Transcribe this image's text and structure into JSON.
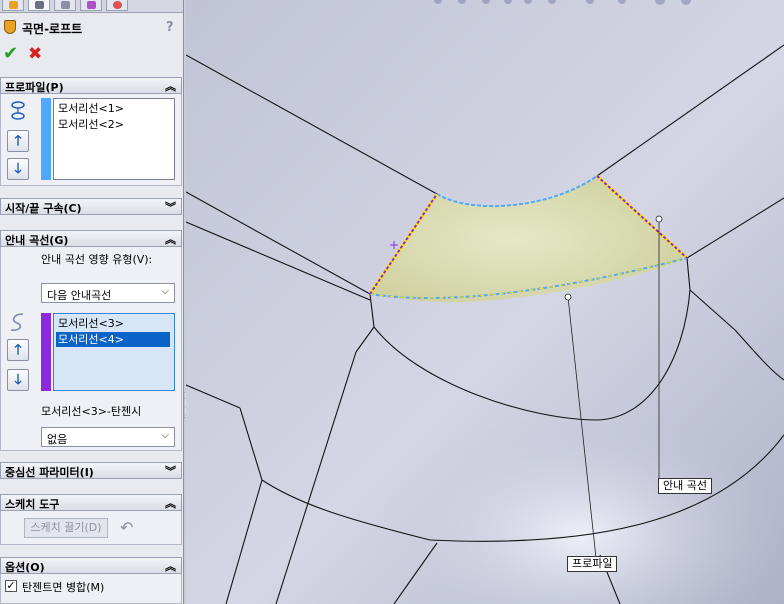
{
  "panel": {
    "title": "곡면-로프트",
    "help": "?",
    "ok_symbol": "✔",
    "cancel_symbol": "✖",
    "sections": {
      "profile": {
        "header": "프로파일(P)",
        "items": [
          "모서리선<1>",
          "모서리선<2>"
        ]
      },
      "start_end": {
        "header": "시작/끝 구속(C)"
      },
      "guide": {
        "header": "안내 곡선(G)",
        "influence_label": "안내 곡선 영향 유형(V):",
        "influence_value": "다음 안내곡선",
        "items": [
          "모서리선<3>",
          "모서리선<4>"
        ],
        "selected_index": 1,
        "tangent_label": "모서리선<3>-탄젠시",
        "tangent_value": "없음"
      },
      "centerline": {
        "header": "중심선 파라미터(I)"
      },
      "sketch_tools": {
        "header": "스케치 도구",
        "drag_sketch": "스케치 끌기(D)"
      },
      "options": {
        "header": "옵션(O)",
        "merge_tangent": "탄젠트면 병합(M)",
        "merge_checked": true
      }
    }
  },
  "viewport": {
    "callouts": {
      "guide": "안내 곡선",
      "profile": "프로파일"
    }
  },
  "colors": {
    "surface_fill": "#d7d9a8",
    "profile_edge": "#4fa8ff",
    "guide_edge": "#8a2be2",
    "highlight": "#ffe000",
    "selection": "#0a64c8"
  }
}
